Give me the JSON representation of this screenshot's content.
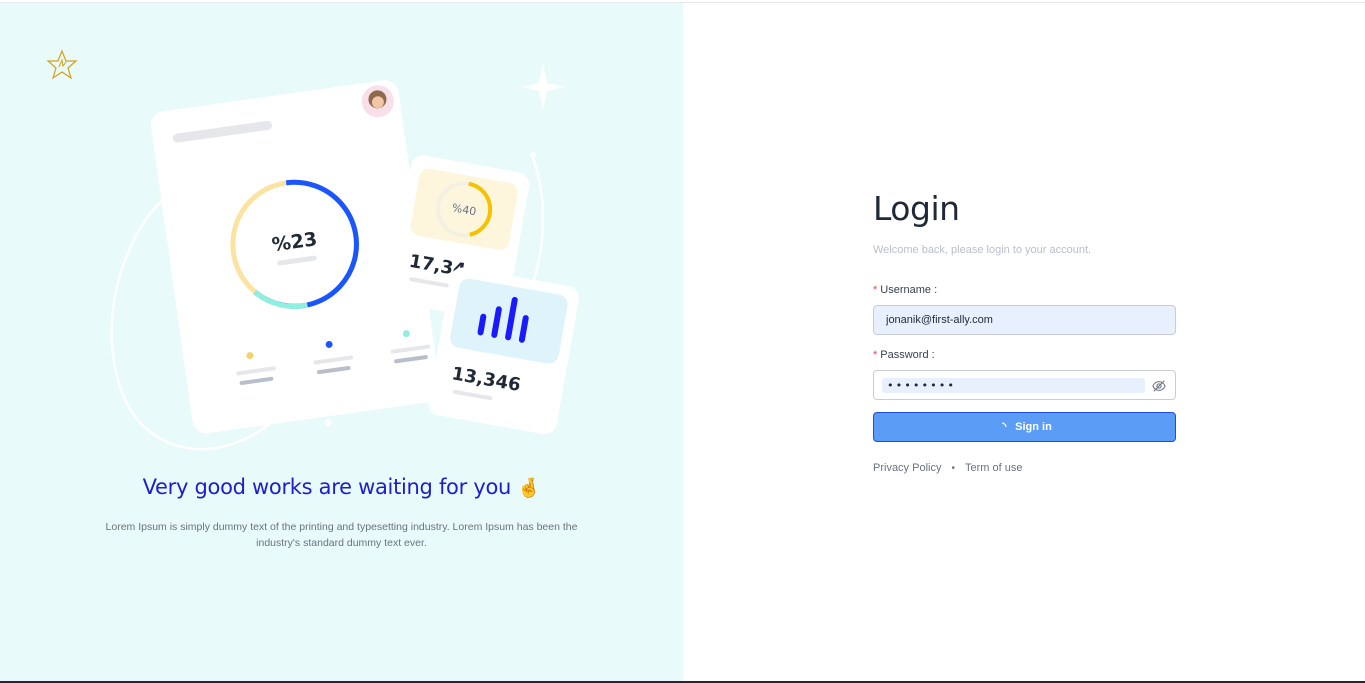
{
  "hero": {
    "title": "Very good works are waiting for you",
    "emoji": "🤞",
    "description": "Lorem Ipsum is simply dummy text of the printing and typesetting industry. Lorem Ipsum has been the industry's standard dummy text ever.",
    "card_main_value": "%23",
    "card_small_value": "%40",
    "card_number_1": "17,34",
    "card_number_2": "13,346",
    "colors": {
      "background": "#e8fafa",
      "accent_blue": "#1a56ff",
      "accent_yellow": "#f6c200",
      "accent_teal": "#8ef0e0"
    }
  },
  "login": {
    "title": "Login",
    "subtitle": "Welcome back, please login to your account.",
    "username_label": "Username :",
    "username_required": "*",
    "username_value": "jonanik@first-ally.com",
    "password_label": "Password :",
    "password_required": "*",
    "password_value": "••••••••",
    "password_toggle_icon": "eye-slash-icon",
    "signin_label": "Sign in",
    "signin_icon": "loading-spinner-icon",
    "privacy_link": "Privacy Policy",
    "separator": "•",
    "terms_link": "Term of use",
    "colors": {
      "button": "#5b9cf7",
      "required": "#ef4444",
      "input_fill": "#e8f0fe"
    }
  }
}
